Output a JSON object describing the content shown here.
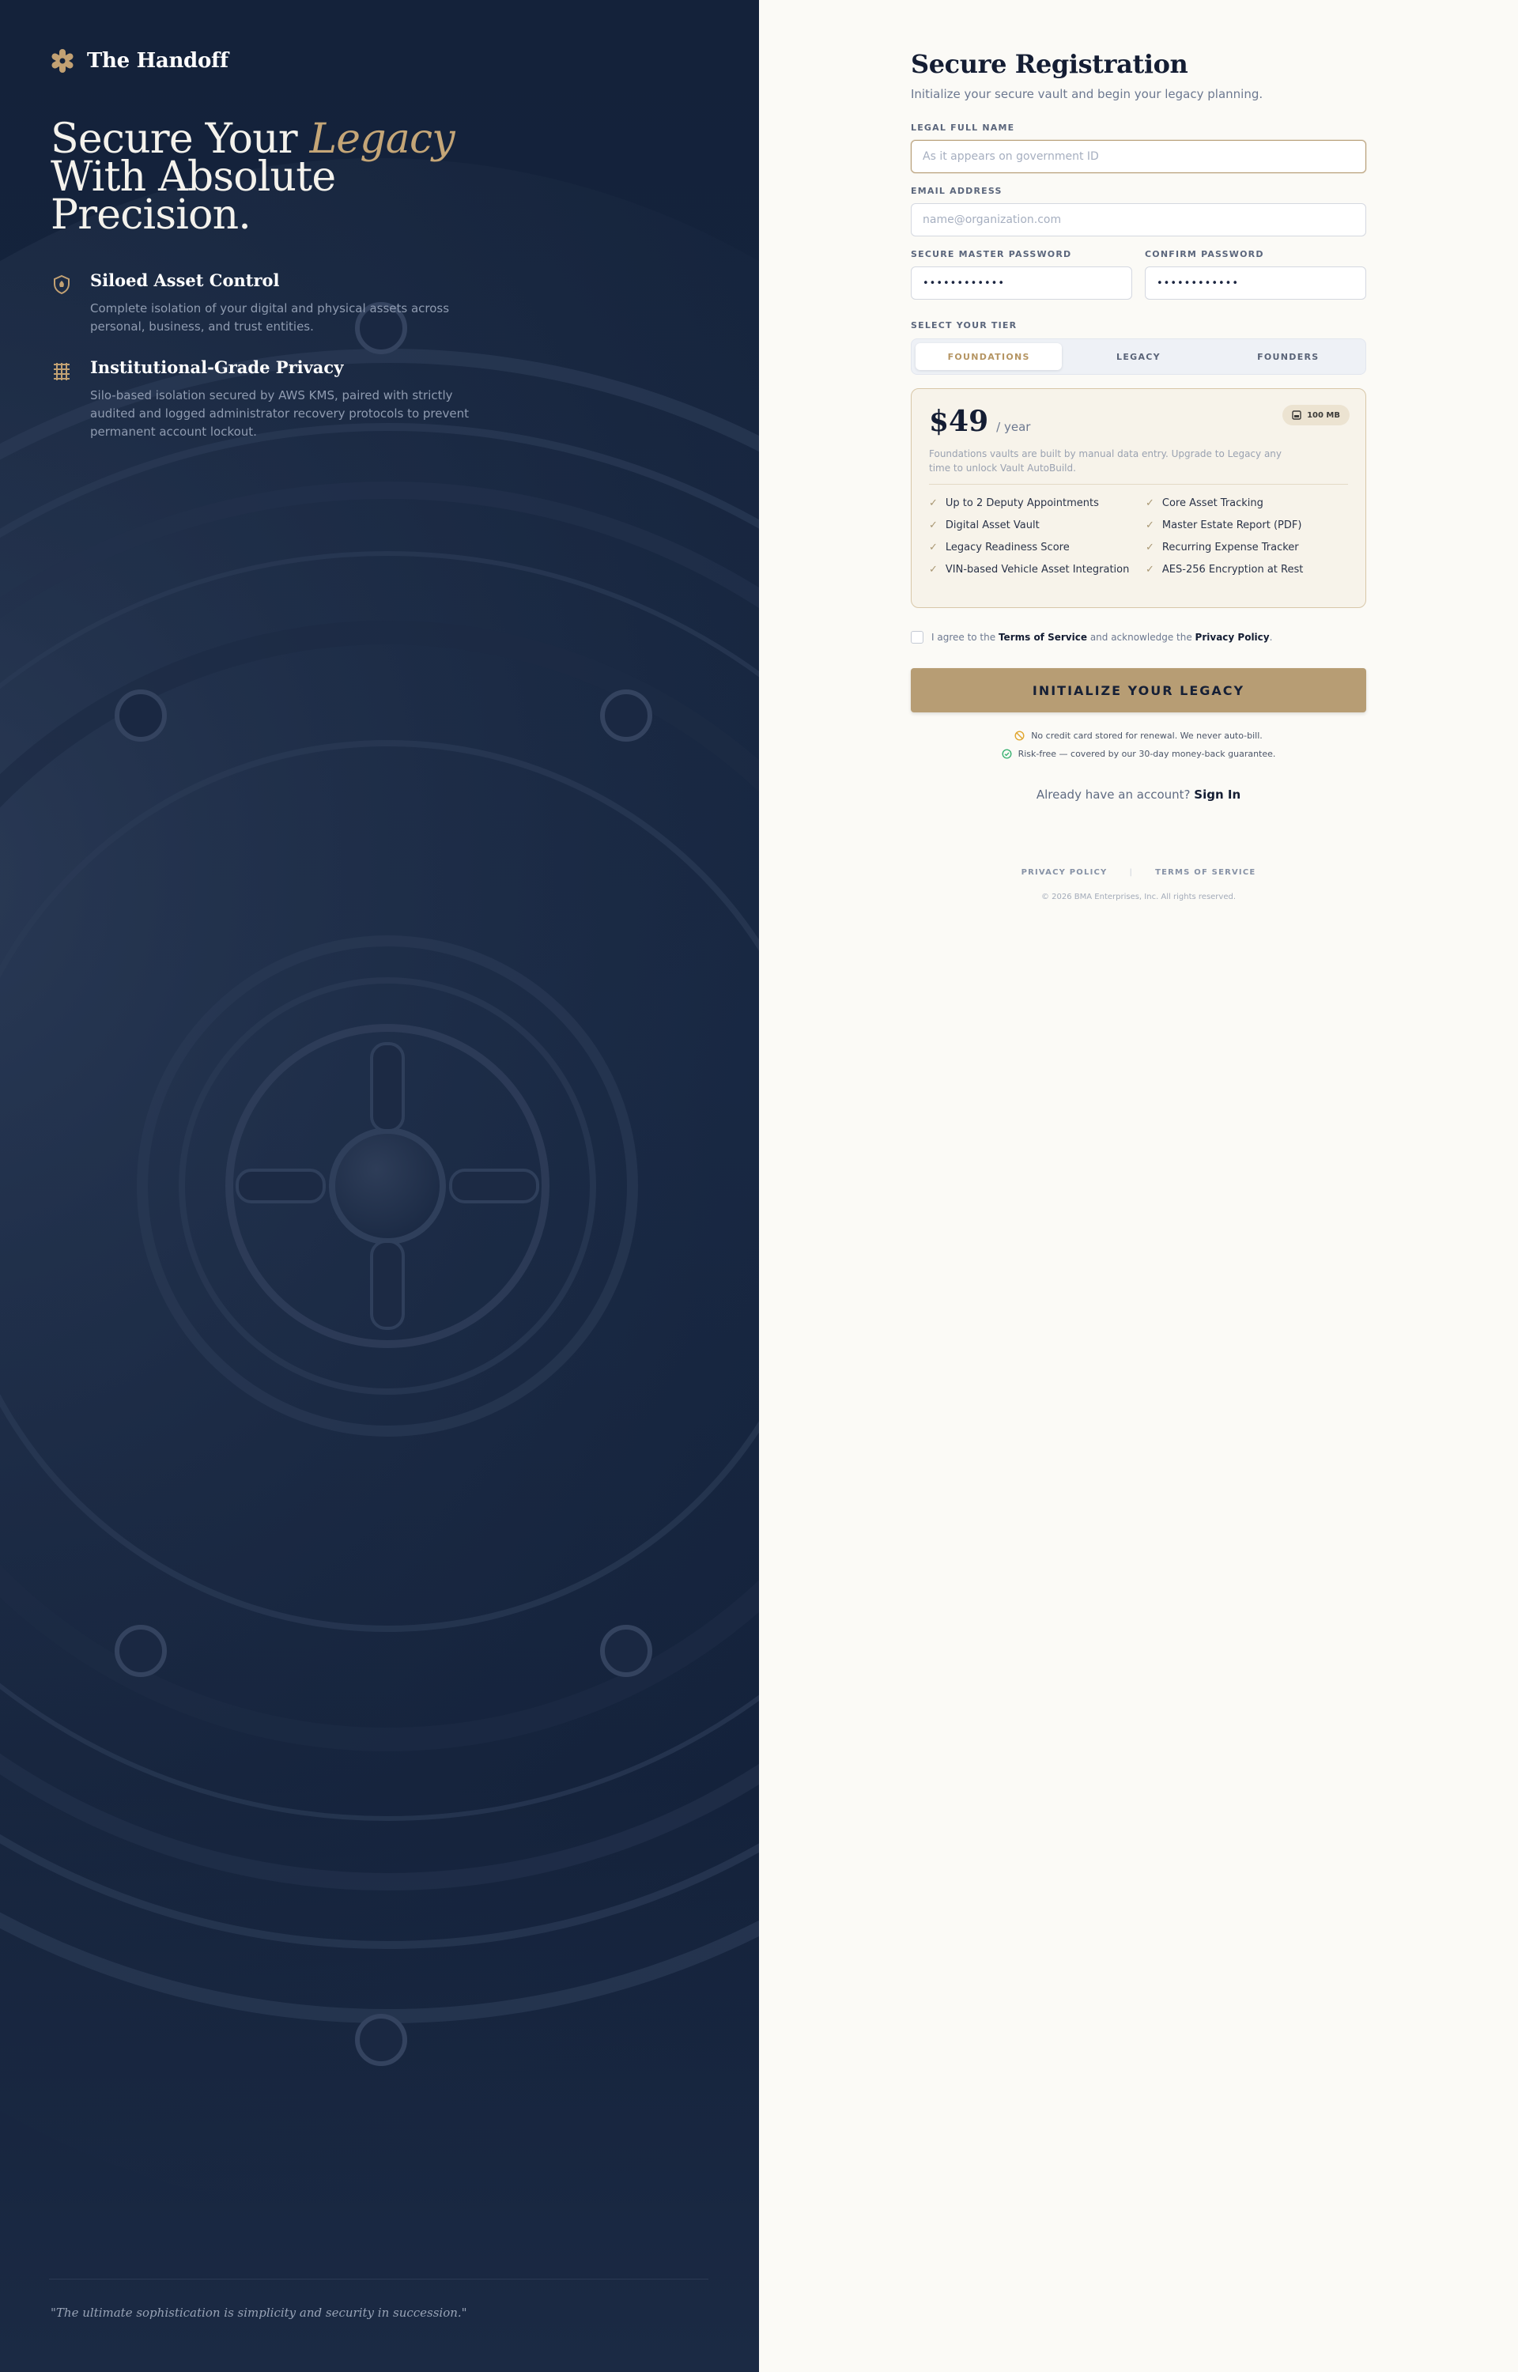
{
  "brand": {
    "name": "The Handoff"
  },
  "hero": {
    "line1": "Secure Your ",
    "accent": "Legacy",
    "line2": "With Absolute",
    "line3": "Precision."
  },
  "features": [
    {
      "icon": "shield-icon",
      "title": "Siloed Asset Control",
      "description": "Complete isolation of your digital and physical assets across personal, business, and trust entities."
    },
    {
      "icon": "grid-lock-icon",
      "title": "Institutional-Grade Privacy",
      "description": "Silo-based isolation secured by AWS KMS, paired with strictly audited and logged administrator recovery protocols to prevent permanent account lockout."
    }
  ],
  "quote": "\"The ultimate sophistication is simplicity and security in succession.\"",
  "form": {
    "title": "Secure Registration",
    "subtitle": "Initialize your secure vault and begin your legacy planning.",
    "legal_name": {
      "label": "Legal Full Name",
      "placeholder": "As it appears on government ID",
      "value": ""
    },
    "email": {
      "label": "Email Address",
      "placeholder": "name@organization.com",
      "value": ""
    },
    "password": {
      "label": "Secure Master Password",
      "value": "••••••••••••"
    },
    "confirm_password": {
      "label": "Confirm Password",
      "value": "••••••••••••"
    },
    "tier": {
      "label": "Select Your Tier",
      "tabs": [
        "FOUNDATIONS",
        "LEGACY",
        "FOUNDERS"
      ],
      "selected": "FOUNDATIONS"
    },
    "plan": {
      "price": "$49",
      "period": "/ year",
      "storage": "100 MB",
      "description": "Foundations vaults are built by manual data entry. Upgrade to Legacy any time to unlock Vault AutoBuild.",
      "features": [
        "Up to 2 Deputy Appointments",
        "Core Asset Tracking",
        "Digital Asset Vault",
        "Master Estate Report (PDF)",
        "Legacy Readiness Score",
        "Recurring Expense Tracker",
        "VIN-based Vehicle Asset Integration",
        "AES-256 Encryption at Rest"
      ]
    },
    "agree": {
      "prefix": "I agree to the",
      "tos": "Terms of Service",
      "middle": "and acknowledge the",
      "privacy": "Privacy Policy",
      "suffix": "."
    },
    "submit_label": "INITIALIZE YOUR LEGACY",
    "notes": [
      "No credit card stored for renewal. We never auto-bill.",
      "Risk-free — covered by our 30-day money-back guarantee."
    ],
    "signin": {
      "prompt": "Already have an account?",
      "link": "Sign In"
    },
    "footer": {
      "privacy": "PRIVACY POLICY",
      "separator": "|",
      "terms": "TERMS OF SERVICE",
      "copyright": "© 2026 BMA Enterprises, Inc. All rights reserved."
    }
  },
  "colors": {
    "navy": "#14223a",
    "gold": "#b79d74",
    "accent_text": "#c5a677",
    "success": "#3bb273",
    "warning": "#e1a62f"
  }
}
